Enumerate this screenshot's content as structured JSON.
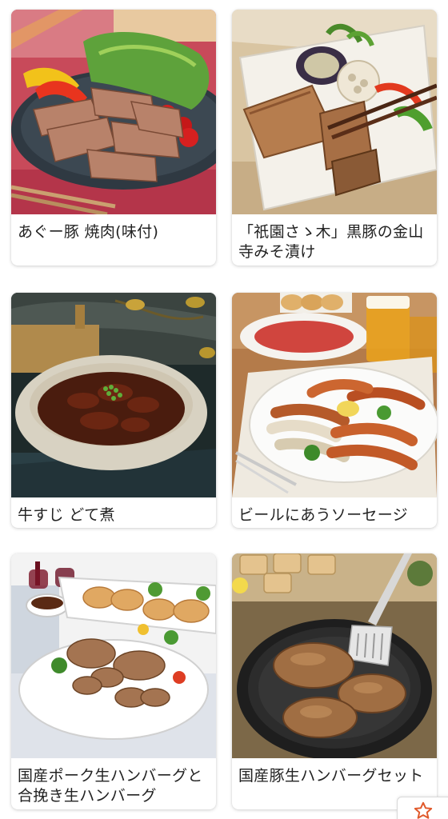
{
  "products": [
    {
      "name": "あぐー豚 焼肉(味付)",
      "image": "grilled-pork-plate-image"
    },
    {
      "name": "「祇園さゝ木」黒豚の金山寺みそ漬け",
      "image": "miso-pork-plate-image"
    },
    {
      "name": "牛すじ どて煮",
      "image": "beef-tendon-stew-image"
    },
    {
      "name": "ビールにあうソーセージ",
      "image": "sausage-platter-image"
    },
    {
      "name": "国産ポーク生ハンバーグと合挽き生ハンバーグ",
      "image": "hamburg-platter-image"
    },
    {
      "name": "国産豚生ハンバーグセット",
      "image": "hamburg-pan-image"
    }
  ],
  "favorite_button": {
    "icon": "star-icon",
    "color": "#e0582a"
  }
}
